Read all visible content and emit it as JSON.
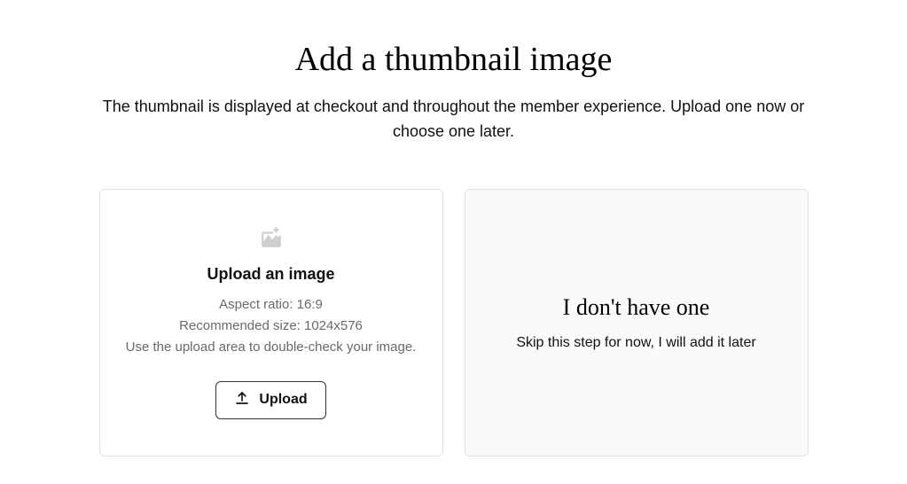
{
  "header": {
    "title": "Add a thumbnail image",
    "subtitle": "The thumbnail is displayed at checkout and throughout the member experience. Upload one now or choose one later."
  },
  "upload_card": {
    "title": "Upload an image",
    "aspect_ratio_line": "Aspect ratio: 16:9",
    "recommended_line": "Recommended size: 1024x576",
    "helper_line": "Use the upload area to double-check your image.",
    "button_label": "Upload"
  },
  "skip_card": {
    "title": "I don't have one",
    "description": "Skip this step for now, I will add it later"
  }
}
